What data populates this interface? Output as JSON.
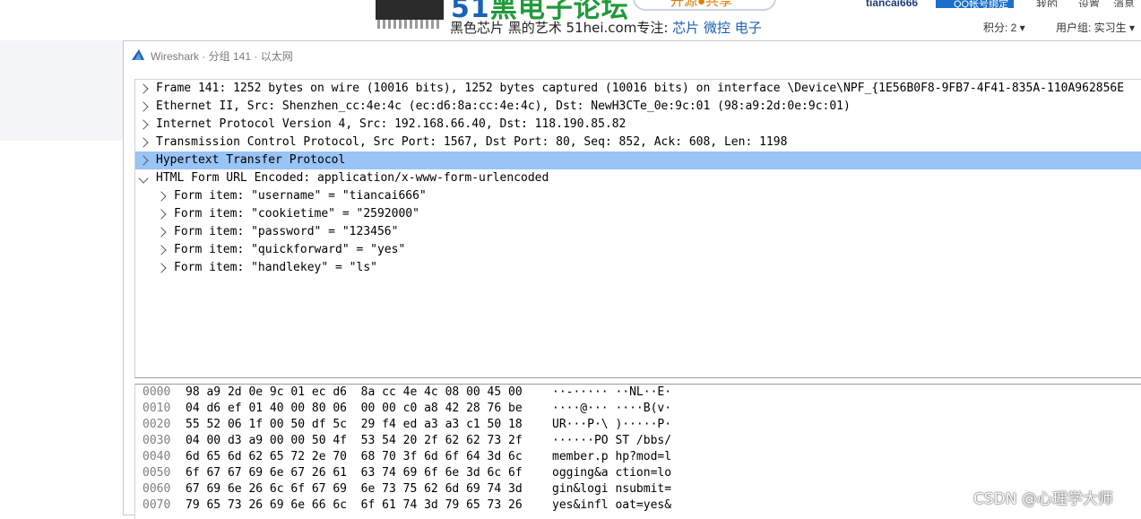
{
  "forum": {
    "logo_number": "51",
    "logo_text": "黑电子论坛",
    "tagline_prefix": "黑色芯片 黑的艺术  51hei.com专注: ",
    "tagline_links": [
      "芯片",
      "微控",
      "电子"
    ],
    "promo": "开源●共享",
    "username": "tiancai666",
    "qq_badge": "QQ帐号绑定",
    "me_link": "我的",
    "settings_link": "设置",
    "messages_link": "消息",
    "points": "积分: 2",
    "user_group": "用户组: 实习生"
  },
  "window": {
    "title": "Wireshark · 分组 141 · 以太网"
  },
  "tree": [
    {
      "level": 0,
      "expanded": false,
      "selected": false,
      "text": "Frame 141: 1252 bytes on wire (10016 bits), 1252 bytes captured (10016 bits) on interface \\Device\\NPF_{1E56B0F8-9FB7-4F41-835A-110A962856E"
    },
    {
      "level": 0,
      "expanded": false,
      "selected": false,
      "text": "Ethernet II, Src: Shenzhen_cc:4e:4c (ec:d6:8a:cc:4e:4c), Dst: NewH3CTe_0e:9c:01 (98:a9:2d:0e:9c:01)"
    },
    {
      "level": 0,
      "expanded": false,
      "selected": false,
      "text": "Internet Protocol Version 4, Src: 192.168.66.40, Dst: 118.190.85.82"
    },
    {
      "level": 0,
      "expanded": false,
      "selected": false,
      "text": "Transmission Control Protocol, Src Port: 1567, Dst Port: 80, Seq: 852, Ack: 608, Len: 1198"
    },
    {
      "level": 0,
      "expanded": false,
      "selected": true,
      "text": "Hypertext Transfer Protocol"
    },
    {
      "level": 0,
      "expanded": true,
      "selected": false,
      "text": "HTML Form URL Encoded: application/x-www-form-urlencoded"
    },
    {
      "level": 1,
      "expanded": false,
      "selected": false,
      "text": "Form item: \"username\" = \"tiancai666\""
    },
    {
      "level": 1,
      "expanded": false,
      "selected": false,
      "text": "Form item: \"cookietime\" = \"2592000\""
    },
    {
      "level": 1,
      "expanded": false,
      "selected": false,
      "text": "Form item: \"password\" = \"123456\""
    },
    {
      "level": 1,
      "expanded": false,
      "selected": false,
      "text": "Form item: \"quickforward\" = \"yes\""
    },
    {
      "level": 1,
      "expanded": false,
      "selected": false,
      "text": "Form item: \"handlekey\" = \"ls\""
    }
  ],
  "hex": [
    {
      "offset": "0000",
      "bytes": "98 a9 2d 0e 9c 01 ec d6  8a cc 4e 4c 08 00 45 00",
      "ascii": "··-····· ··NL··E·"
    },
    {
      "offset": "0010",
      "bytes": "04 d6 ef 01 40 00 80 06  00 00 c0 a8 42 28 76 be",
      "ascii": "····@··· ····B(v·"
    },
    {
      "offset": "0020",
      "bytes": "55 52 06 1f 00 50 df 5c  29 f4 ed a3 a3 c1 50 18",
      "ascii": "UR···P·\\ )·····P·"
    },
    {
      "offset": "0030",
      "bytes": "04 00 d3 a9 00 00 50 4f  53 54 20 2f 62 62 73 2f",
      "ascii": "······PO ST /bbs/"
    },
    {
      "offset": "0040",
      "bytes": "6d 65 6d 62 65 72 2e 70  68 70 3f 6d 6f 64 3d 6c",
      "ascii": "member.p hp?mod=l"
    },
    {
      "offset": "0050",
      "bytes": "6f 67 67 69 6e 67 26 61  63 74 69 6f 6e 3d 6c 6f",
      "ascii": "ogging&a ction=lo"
    },
    {
      "offset": "0060",
      "bytes": "67 69 6e 26 6c 6f 67 69  6e 73 75 62 6d 69 74 3d",
      "ascii": "gin&logi nsubmit="
    },
    {
      "offset": "0070",
      "bytes": "79 65 73 26 69 6e 66 6c  6f 61 74 3d 79 65 73 26",
      "ascii": "yes&infl oat=yes&"
    }
  ],
  "watermark": "CSDN @心理学大师",
  "colors": {
    "selected_row": "#99c4f5",
    "link_blue": "#1b5fb5",
    "wireshark_fin": "#1a62b8"
  }
}
